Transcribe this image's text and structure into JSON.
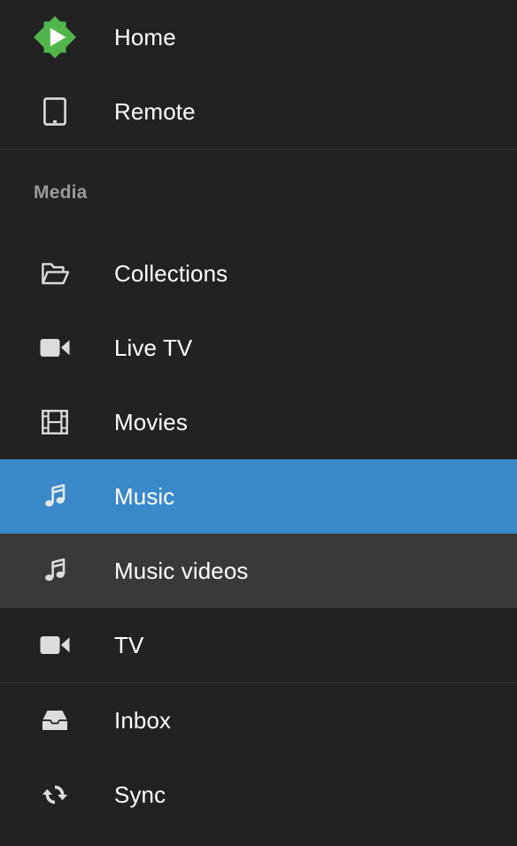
{
  "drawer": {
    "background_color": "#222222",
    "selected_color": "#3a89c9",
    "hover_color": "#393939",
    "brand_color": "#52b54b",
    "items": [
      {
        "label": "Home",
        "icon": "emby-logo-icon",
        "state": "default"
      },
      {
        "label": "Remote",
        "icon": "tablet-icon",
        "state": "default"
      }
    ],
    "section": {
      "title": "Media",
      "items": [
        {
          "label": "Collections",
          "icon": "folder-open-icon",
          "state": "default"
        },
        {
          "label": "Live TV",
          "icon": "videocam-icon",
          "state": "default"
        },
        {
          "label": "Movies",
          "icon": "film-strip-icon",
          "state": "default"
        },
        {
          "label": "Music",
          "icon": "music-note-icon",
          "state": "selected"
        },
        {
          "label": "Music videos",
          "icon": "music-note-icon",
          "state": "hovered"
        },
        {
          "label": "TV",
          "icon": "videocam-icon",
          "state": "default"
        }
      ]
    },
    "footer_items": [
      {
        "label": "Inbox",
        "icon": "inbox-icon",
        "state": "default"
      },
      {
        "label": "Sync",
        "icon": "sync-icon",
        "state": "default"
      }
    ]
  }
}
